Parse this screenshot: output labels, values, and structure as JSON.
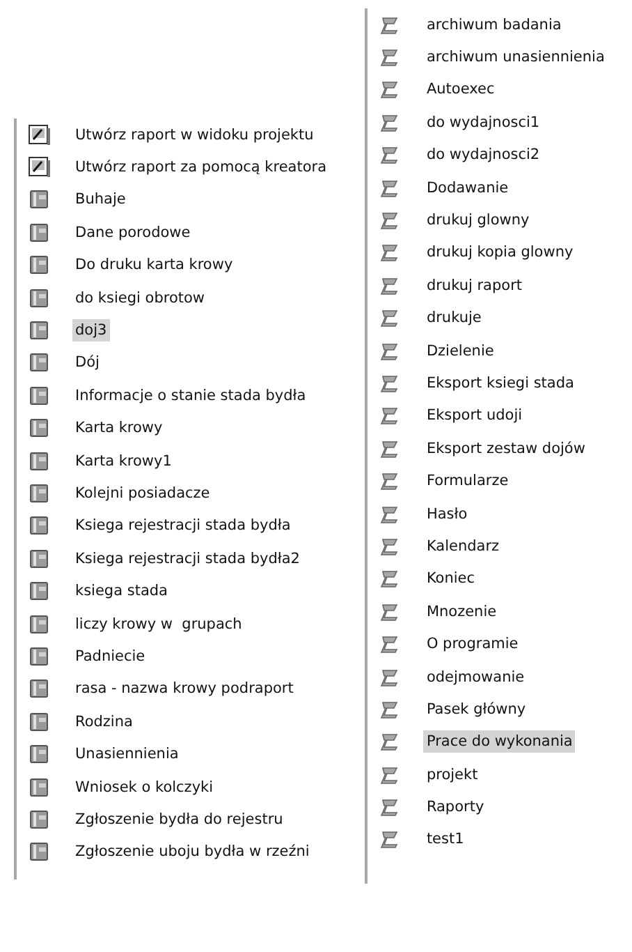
{
  "reports": [
    {
      "kind": "wizard",
      "label": "Utwórz raport w widoku projektu",
      "selected": false
    },
    {
      "kind": "wizard",
      "label": "Utwórz raport za pomocą kreatora",
      "selected": false
    },
    {
      "kind": "report",
      "label": "Buhaje",
      "selected": false
    },
    {
      "kind": "report",
      "label": "Dane porodowe",
      "selected": false
    },
    {
      "kind": "report",
      "label": "Do druku karta krowy",
      "selected": false
    },
    {
      "kind": "report",
      "label": "do ksiegi obrotow",
      "selected": false
    },
    {
      "kind": "report",
      "label": "doj3",
      "selected": true
    },
    {
      "kind": "report",
      "label": "Dój",
      "selected": false
    },
    {
      "kind": "report",
      "label": "Informacje o stanie stada bydła",
      "selected": false
    },
    {
      "kind": "report",
      "label": "Karta krowy",
      "selected": false
    },
    {
      "kind": "report",
      "label": "Karta krowy1",
      "selected": false
    },
    {
      "kind": "report",
      "label": "Kolejni posiadacze",
      "selected": false
    },
    {
      "kind": "report",
      "label": "Ksiega rejestracji stada bydła",
      "selected": false
    },
    {
      "kind": "report",
      "label": "Ksiega rejestracji stada bydła2",
      "selected": false
    },
    {
      "kind": "report",
      "label": "ksiega stada",
      "selected": false
    },
    {
      "kind": "report",
      "label": "liczy krowy w  grupach",
      "selected": false
    },
    {
      "kind": "report",
      "label": "Padniecie",
      "selected": false
    },
    {
      "kind": "report",
      "label": "rasa - nazwa krowy podraport",
      "selected": false
    },
    {
      "kind": "report",
      "label": "Rodzina",
      "selected": false
    },
    {
      "kind": "report",
      "label": "Unasiennienia",
      "selected": false
    },
    {
      "kind": "report",
      "label": "Wniosek o kolczyki",
      "selected": false
    },
    {
      "kind": "report",
      "label": "Zgłoszenie bydła do rejestru",
      "selected": false
    },
    {
      "kind": "report",
      "label": "Zgłoszenie uboju bydła w rzeźni",
      "selected": false
    }
  ],
  "macros": [
    {
      "kind": "macro",
      "label": "archiwum badania",
      "selected": false
    },
    {
      "kind": "macro",
      "label": "archiwum unasiennienia",
      "selected": false
    },
    {
      "kind": "macro",
      "label": "Autoexec",
      "selected": false
    },
    {
      "kind": "macro",
      "label": "do wydajnosci1",
      "selected": false
    },
    {
      "kind": "macro",
      "label": "do wydajnosci2",
      "selected": false
    },
    {
      "kind": "macro",
      "label": "Dodawanie",
      "selected": false
    },
    {
      "kind": "macro",
      "label": "drukuj glowny",
      "selected": false
    },
    {
      "kind": "macro",
      "label": "drukuj kopia glowny",
      "selected": false
    },
    {
      "kind": "macro",
      "label": "drukuj raport",
      "selected": false
    },
    {
      "kind": "macro",
      "label": "drukuje",
      "selected": false
    },
    {
      "kind": "macro",
      "label": "Dzielenie",
      "selected": false
    },
    {
      "kind": "macro",
      "label": "Eksport ksiegi stada",
      "selected": false
    },
    {
      "kind": "macro",
      "label": "Eksport udoji",
      "selected": false
    },
    {
      "kind": "macro",
      "label": "Eksport zestaw dojów",
      "selected": false
    },
    {
      "kind": "macro",
      "label": "Formularze",
      "selected": false
    },
    {
      "kind": "macro",
      "label": "Hasło",
      "selected": false
    },
    {
      "kind": "macro",
      "label": "Kalendarz",
      "selected": false
    },
    {
      "kind": "macro",
      "label": "Koniec",
      "selected": false
    },
    {
      "kind": "macro",
      "label": "Mnozenie",
      "selected": false
    },
    {
      "kind": "macro",
      "label": "O programie",
      "selected": false
    },
    {
      "kind": "macro",
      "label": "odejmowanie",
      "selected": false
    },
    {
      "kind": "macro",
      "label": "Pasek główny",
      "selected": false
    },
    {
      "kind": "macro",
      "label": "Prace do wykonania",
      "selected": true
    },
    {
      "kind": "macro",
      "label": "projekt",
      "selected": false
    },
    {
      "kind": "macro",
      "label": "Raporty",
      "selected": false
    },
    {
      "kind": "macro",
      "label": "test1",
      "selected": false
    }
  ]
}
